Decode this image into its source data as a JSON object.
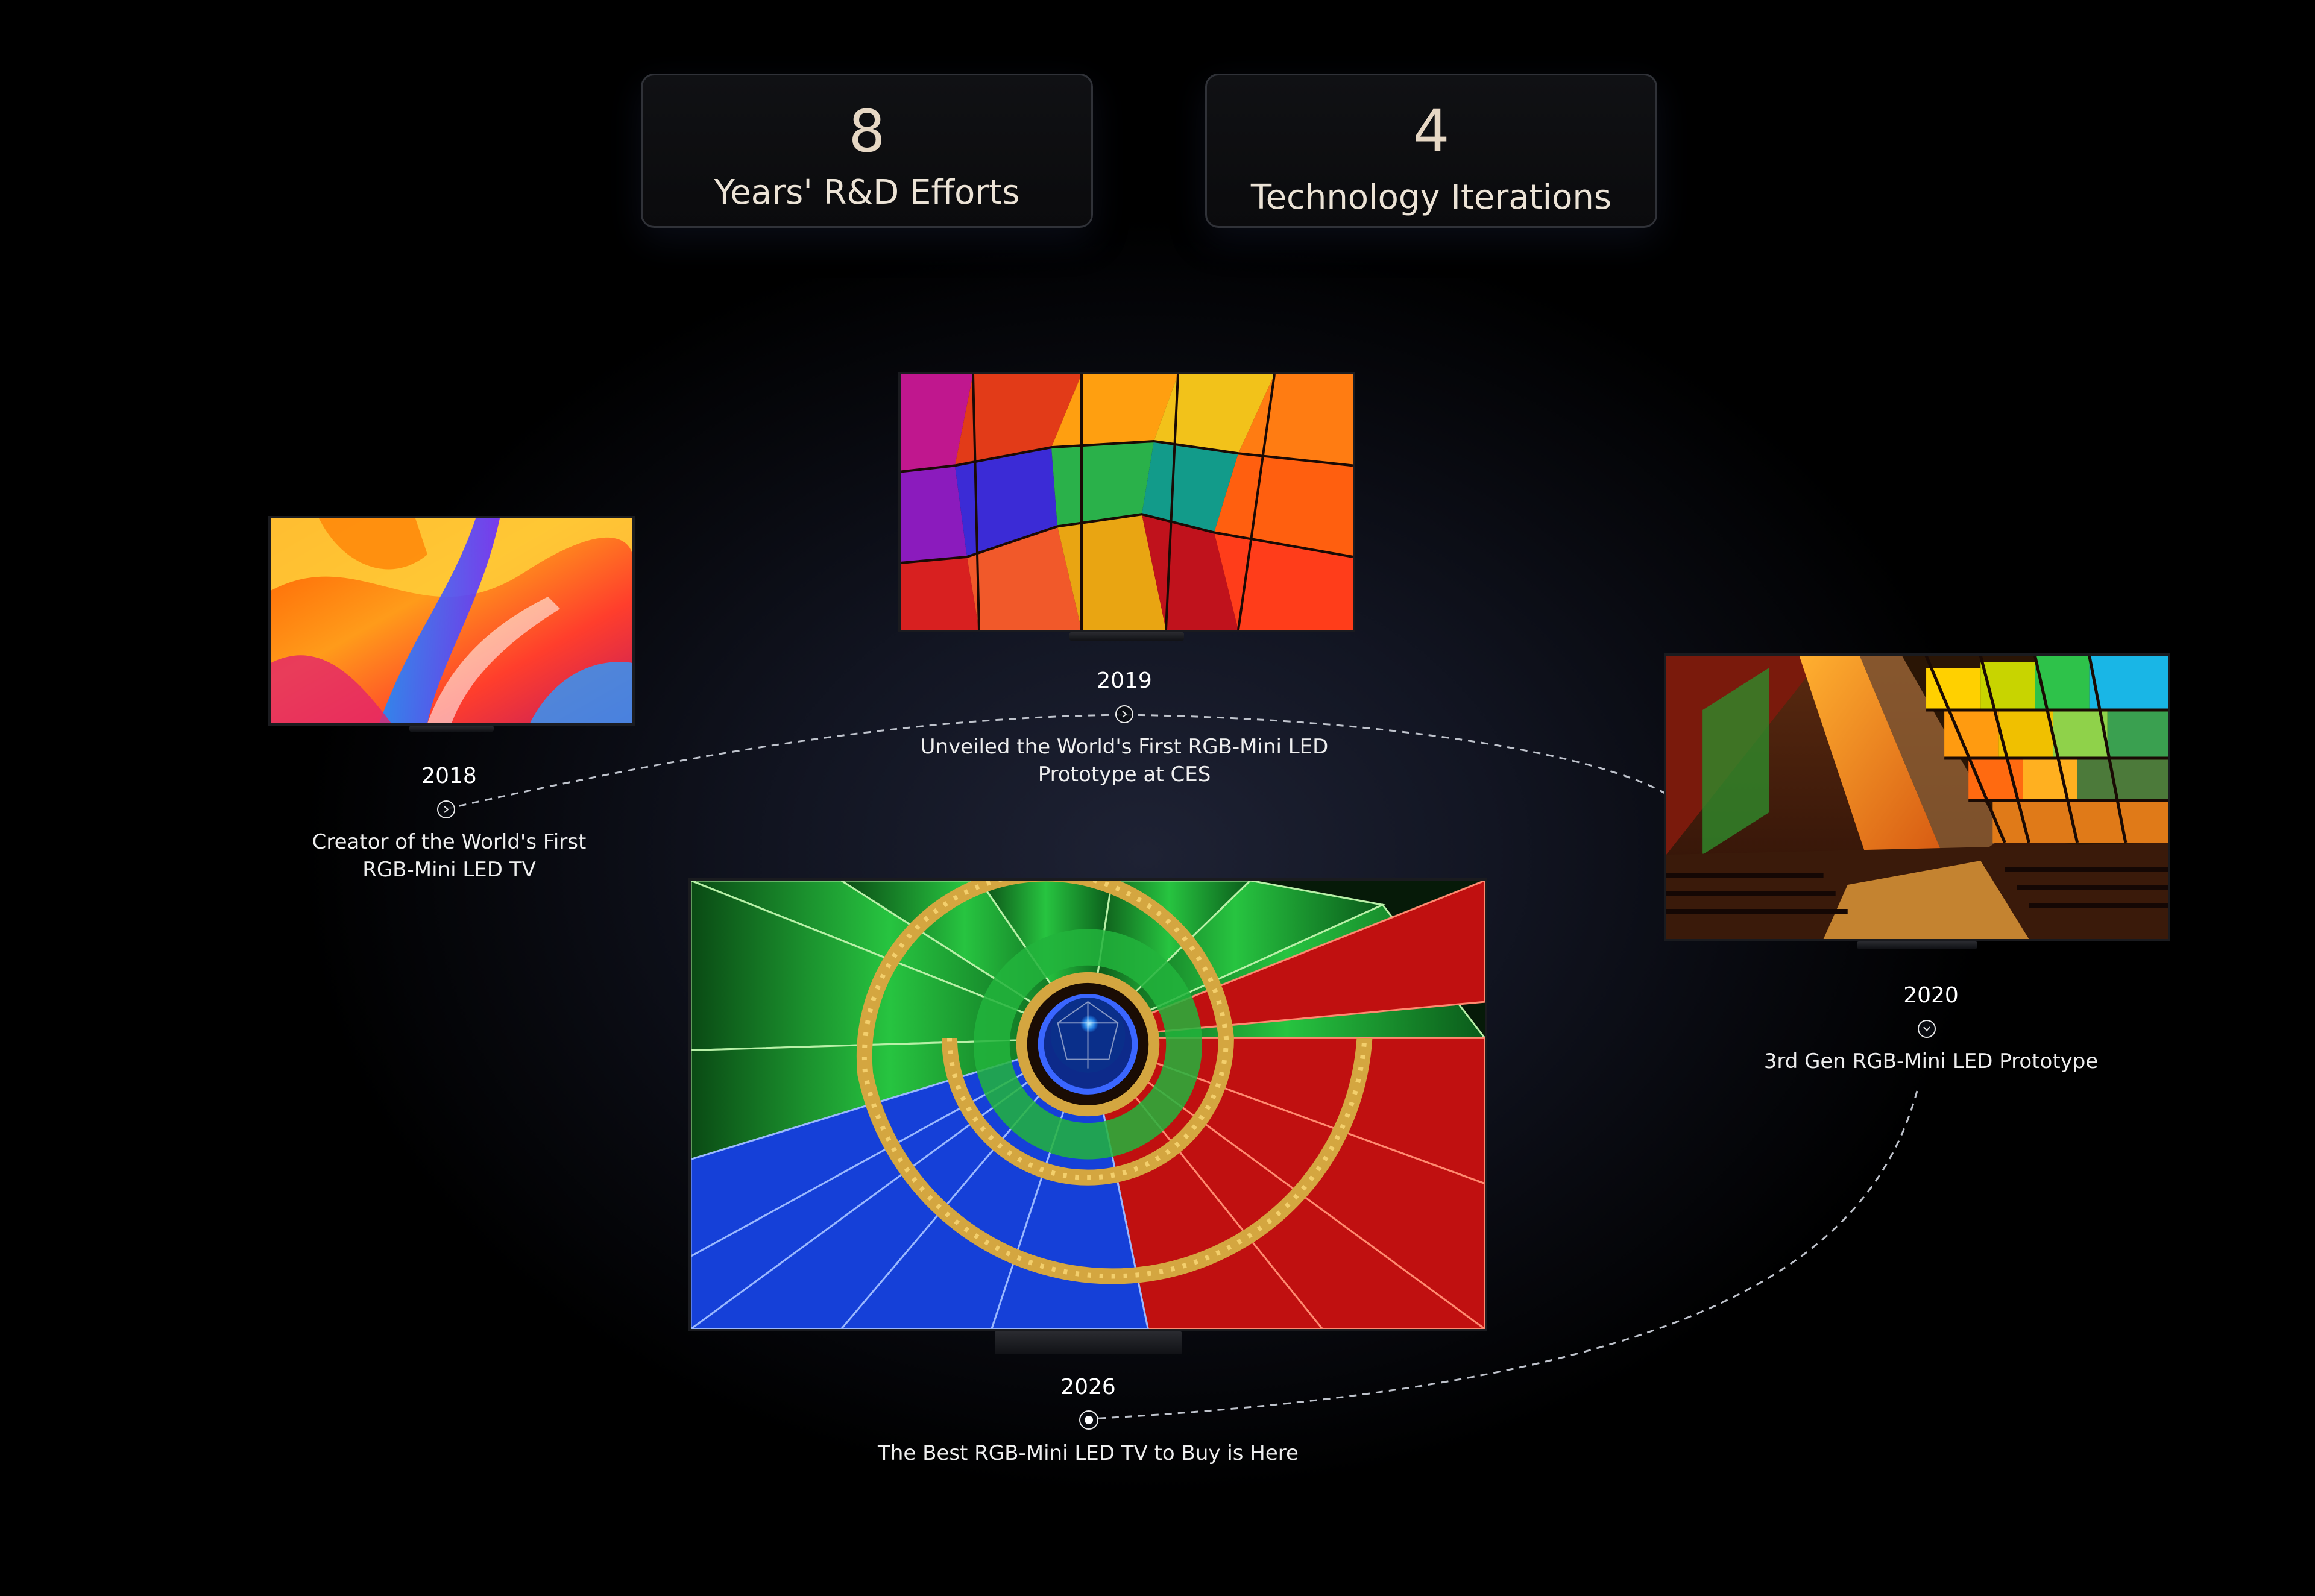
{
  "stats": [
    {
      "number": "8",
      "label": "Years' R&D Efforts"
    },
    {
      "number": "4",
      "label": "Technology Iterations"
    }
  ],
  "milestones": {
    "m2018": {
      "year": "2018",
      "line1": "Creator of the World's First",
      "line2": "RGB-Mini LED TV",
      "node_icon": "chevron-right-icon"
    },
    "m2019": {
      "year": "2019",
      "line1": "Unveiled the World's First RGB-Mini LED",
      "line2": "Prototype at CES",
      "node_icon": "chevron-right-icon"
    },
    "m2020": {
      "year": "2020",
      "line1": "3rd Gen RGB-Mini LED Prototype",
      "node_icon": "chevron-down-icon"
    },
    "m2026": {
      "year": "2026",
      "line1": "The Best RGB-Mini LED TV to Buy is Here",
      "node_icon": "active-dot-icon"
    }
  },
  "colors": {
    "background": "#000000",
    "accent_gold": "#e6d7c4",
    "text": "#ffffff",
    "path_line": "#bfc3cc"
  }
}
